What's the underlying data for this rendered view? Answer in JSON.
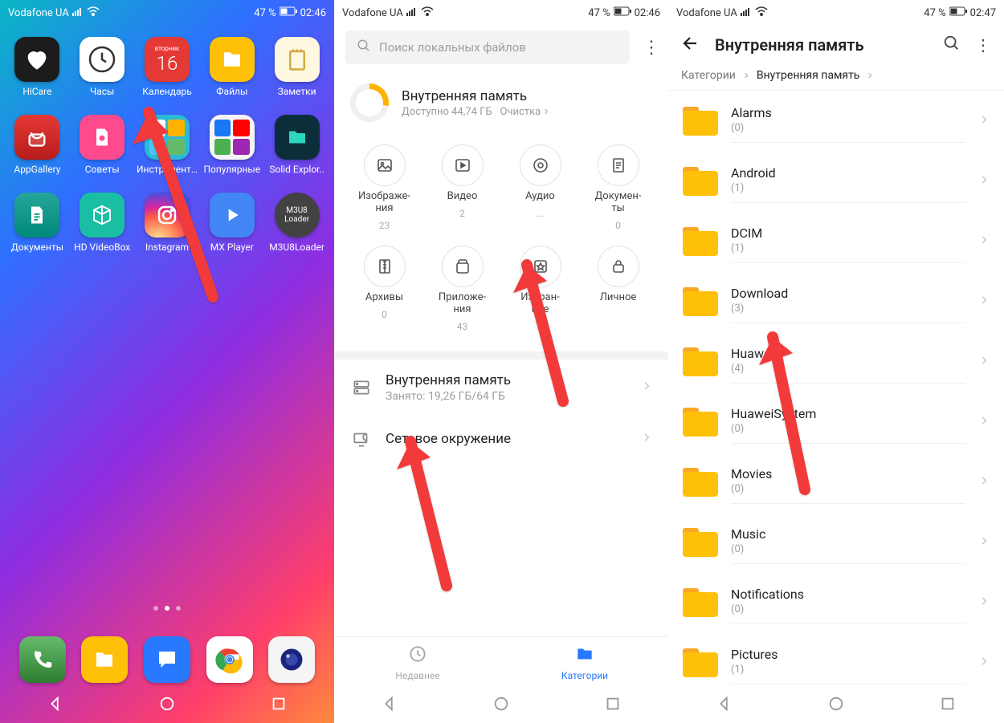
{
  "panel1": {
    "status": {
      "carrier": "Vodafone UA",
      "battery": "47 %",
      "time": "02:46"
    },
    "apps": [
      {
        "label": "HiCare"
      },
      {
        "label": "Часы"
      },
      {
        "label": "Календарь",
        "d": "вторник",
        "n": "16"
      },
      {
        "label": "Файлы"
      },
      {
        "label": "Заметки"
      },
      {
        "label": "AppGallery"
      },
      {
        "label": "Советы"
      },
      {
        "label": "Инструменты"
      },
      {
        "label": "Популярные"
      },
      {
        "label": "Solid Explor.."
      },
      {
        "label": "Документы"
      },
      {
        "label": "HD VideoBox"
      },
      {
        "label": "Instagram"
      },
      {
        "label": "MX Player"
      },
      {
        "label": "M3U8Loader",
        "m": "M3U8\nLoader"
      }
    ]
  },
  "panel2": {
    "status": {
      "carrier": "Vodafone UA",
      "battery": "47 %",
      "time": "02:46"
    },
    "search_placeholder": "Поиск локальных файлов",
    "storage": {
      "title": "Внутренняя память",
      "avail": "Доступно 44,74 ГБ",
      "clean": "Очистка"
    },
    "cats": [
      {
        "l": "Изображе-\nния",
        "n": "23"
      },
      {
        "l": "Видео",
        "n": "2"
      },
      {
        "l": "Аудио",
        "n": "..."
      },
      {
        "l": "Докумен-\nты",
        "n": "0"
      },
      {
        "l": "Архивы",
        "n": "0"
      },
      {
        "l": "Приложе-\nния",
        "n": "43"
      },
      {
        "l": "Избран-\nное",
        "n": "0"
      },
      {
        "l": "Личное",
        "n": ""
      }
    ],
    "internal": {
      "t": "Внутренняя память",
      "s": "Занято: 19,26 ГБ/64 ГБ"
    },
    "network": "Сетевое окружение",
    "tabs": {
      "recent": "Недавнее",
      "categories": "Категории"
    }
  },
  "panel3": {
    "status": {
      "carrier": "Vodafone UA",
      "battery": "47 %",
      "time": "02:47"
    },
    "title": "Внутренняя память",
    "crumb1": "Категории",
    "crumb2": "Внутренняя память",
    "folders": [
      {
        "n": "Alarms",
        "c": "(0)"
      },
      {
        "n": "Android",
        "c": "(1)"
      },
      {
        "n": "DCIM",
        "c": "(1)"
      },
      {
        "n": "Download",
        "c": "(3)"
      },
      {
        "n": "Huawei",
        "c": "(4)"
      },
      {
        "n": "HuaweiSystem",
        "c": "(0)"
      },
      {
        "n": "Movies",
        "c": "(0)"
      },
      {
        "n": "Music",
        "c": "(0)"
      },
      {
        "n": "Notifications",
        "c": "(0)"
      },
      {
        "n": "Pictures",
        "c": "(1)"
      }
    ]
  }
}
